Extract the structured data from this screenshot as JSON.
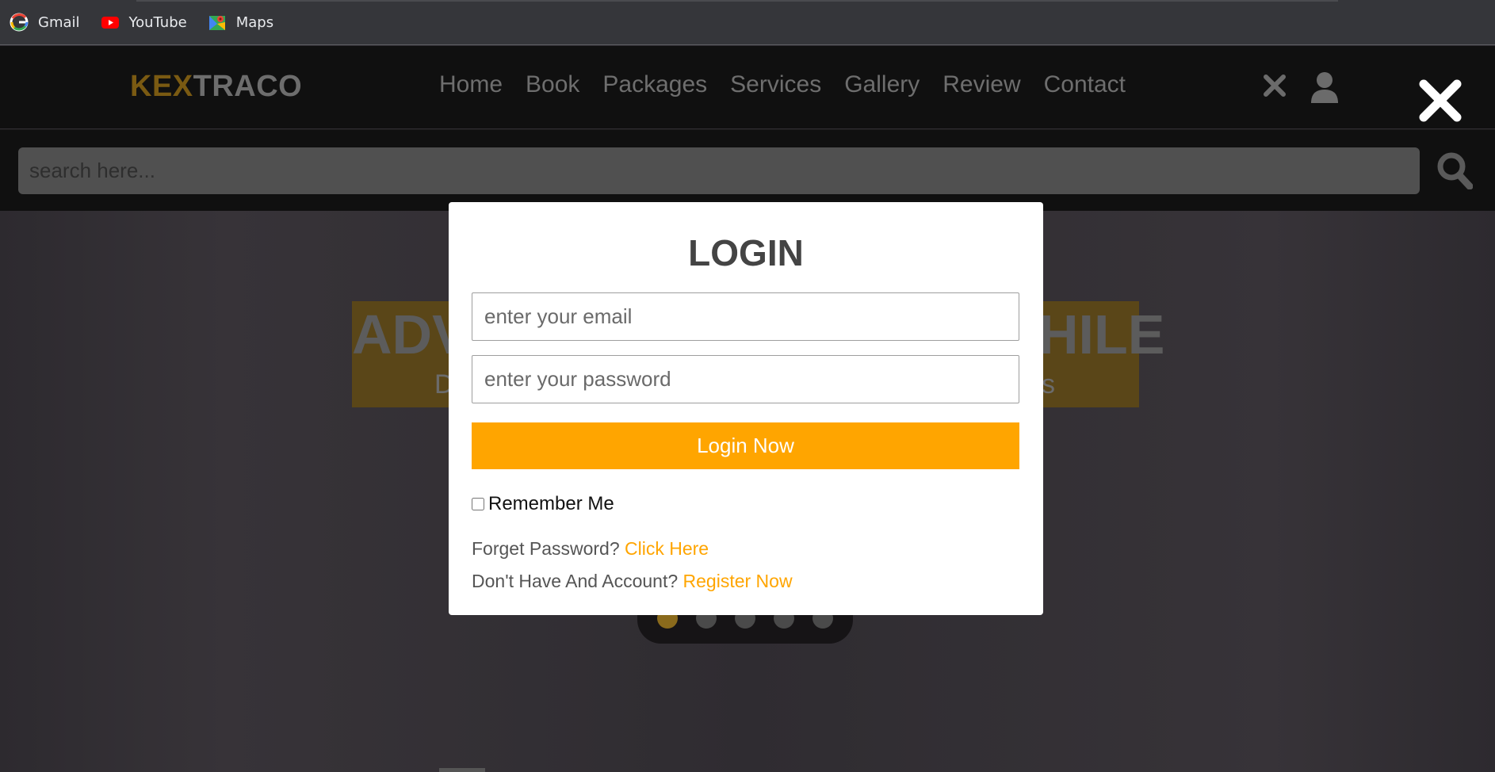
{
  "bookmarks": [
    {
      "label": "Gmail",
      "icon": "google-icon"
    },
    {
      "label": "YouTube",
      "icon": "youtube-icon"
    },
    {
      "label": "Maps",
      "icon": "maps-icon"
    }
  ],
  "site": {
    "logo_accent": "KEX",
    "logo_rest": "TRACO",
    "nav": [
      "Home",
      "Book",
      "Packages",
      "Services",
      "Gallery",
      "Review",
      "Contact"
    ]
  },
  "search": {
    "placeholder": "search here..."
  },
  "hero": {
    "title_left": "ADV",
    "title_right": "HILE",
    "sub_left": "D",
    "sub_right": "s",
    "slides": 5,
    "active_slide": 1
  },
  "login": {
    "title": "LOGIN",
    "email_placeholder": "enter your email",
    "password_placeholder": "enter your password",
    "button": "Login Now",
    "remember": "Remember Me",
    "forget_text": "Forget Password?",
    "forget_link": "Click Here",
    "register_text": "Don't Have And Account?",
    "register_link": "Register Now"
  },
  "colors": {
    "accent": "#ffa500",
    "header_bg": "#101010",
    "overlay_bg": "#2f2c31"
  }
}
